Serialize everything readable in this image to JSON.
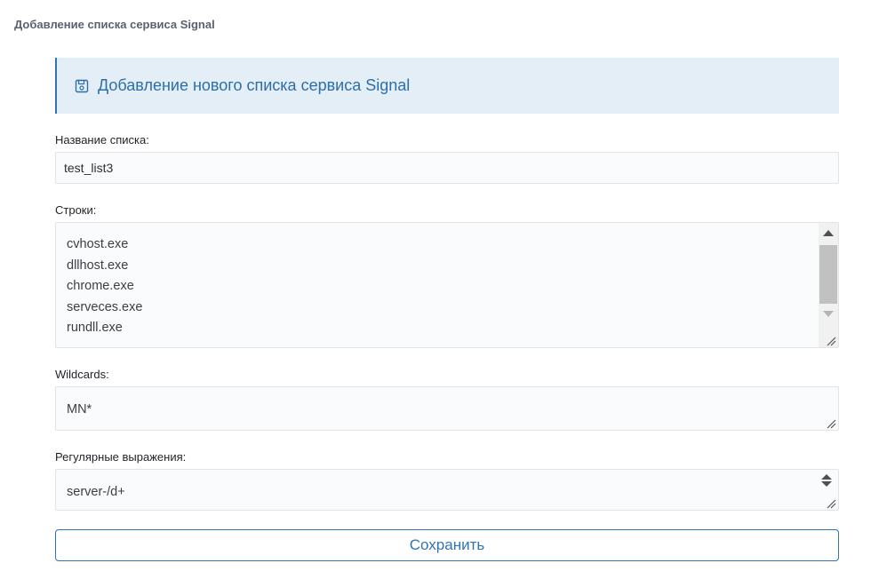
{
  "page": {
    "title": "Добавление списка сервиса Signal"
  },
  "header": {
    "title": "Добавление нового списка сервиса Signal",
    "icon": "save-icon",
    "accent_color": "#2f74b5",
    "background_color": "#e3eef7"
  },
  "form": {
    "list_name": {
      "label": "Название списка:",
      "value": "test_list3"
    },
    "lines": {
      "label": "Строки:",
      "values": [
        "cvhost.exe",
        "dllhost.exe",
        "chrome.exe",
        "serveces.exe",
        "rundll.exe"
      ]
    },
    "wildcards": {
      "label": "Wildcards:",
      "value": "MN*"
    },
    "regex": {
      "label": "Регулярные выражения:",
      "value": "server-/d+"
    },
    "save_label": "Сохранить"
  }
}
